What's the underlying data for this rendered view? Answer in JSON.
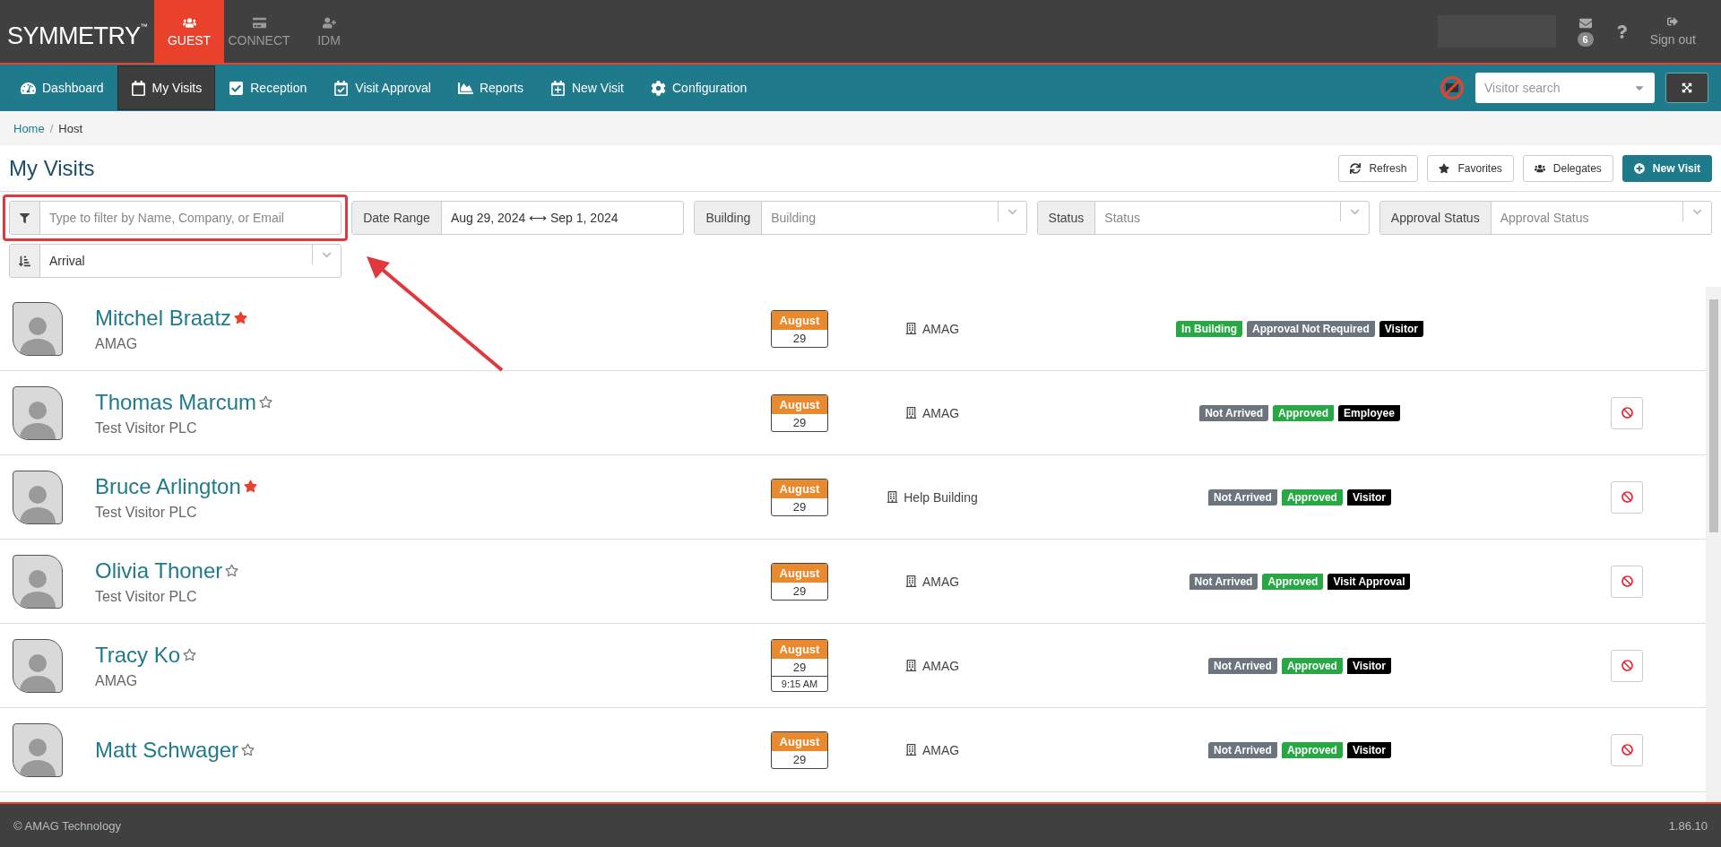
{
  "brand": {
    "name": "SYMMETRY",
    "mark": "™"
  },
  "products": [
    {
      "label": "GUEST",
      "selected": true
    },
    {
      "label": "CONNECT",
      "selected": false
    },
    {
      "label": "IDM",
      "selected": false
    }
  ],
  "user_menu": {
    "mail_count": "6",
    "sign_out": "Sign out"
  },
  "nav": [
    {
      "label": "Dashboard",
      "selected": false
    },
    {
      "label": "My Visits",
      "selected": true
    },
    {
      "label": "Reception",
      "selected": false
    },
    {
      "label": "Visit Approval",
      "selected": false
    },
    {
      "label": "Reports",
      "selected": false
    },
    {
      "label": "New Visit",
      "selected": false
    },
    {
      "label": "Configuration",
      "selected": false
    }
  ],
  "visitor_search": {
    "placeholder": "Visitor search"
  },
  "breadcrumb": {
    "items": [
      "Home",
      "Host"
    ],
    "separator": "/"
  },
  "page_title": "My Visits",
  "actions": [
    {
      "label": "Refresh",
      "primary": false
    },
    {
      "label": "Favorites",
      "primary": false
    },
    {
      "label": "Delegates",
      "primary": false
    },
    {
      "label": "New Visit",
      "primary": true
    }
  ],
  "filter": {
    "placeholder": "Type to filter by Name, Company, or Email"
  },
  "date_range": {
    "label": "Date Range",
    "start": "Aug 29, 2024",
    "separator": "⟷",
    "end": "Sep 1, 2024"
  },
  "selects": [
    {
      "label": "Building",
      "placeholder": "Building"
    },
    {
      "label": "Status",
      "placeholder": "Status"
    },
    {
      "label": "Approval Status",
      "placeholder": "Approval Status"
    }
  ],
  "sort": {
    "value": "Arrival"
  },
  "visits": [
    {
      "name": "Mitchel Braatz",
      "favorite": true,
      "company": "AMAG",
      "month": "August",
      "day": "29",
      "building": "AMAG",
      "cancelable": false,
      "badges": [
        {
          "text": "In Building",
          "color": "#28a745"
        },
        {
          "text": "Approval Not Required",
          "color": "#6c757d"
        },
        {
          "text": "Visitor",
          "color": "#000000"
        }
      ]
    },
    {
      "name": "Thomas Marcum",
      "favorite": false,
      "company": "Test Visitor PLC",
      "month": "August",
      "day": "29",
      "building": "AMAG",
      "cancelable": true,
      "badges": [
        {
          "text": "Not Arrived",
          "color": "#6c757d"
        },
        {
          "text": "Approved",
          "color": "#28a745"
        },
        {
          "text": "Employee",
          "color": "#000000"
        }
      ]
    },
    {
      "name": "Bruce Arlington",
      "favorite": true,
      "company": "Test Visitor PLC",
      "month": "August",
      "day": "29",
      "building": "Help Building",
      "cancelable": true,
      "badges": [
        {
          "text": "Not Arrived",
          "color": "#6c757d"
        },
        {
          "text": "Approved",
          "color": "#28a745"
        },
        {
          "text": "Visitor",
          "color": "#000000"
        }
      ]
    },
    {
      "name": "Olivia Thoner",
      "favorite": false,
      "company": "Test Visitor PLC",
      "month": "August",
      "day": "29",
      "building": "AMAG",
      "cancelable": true,
      "badges": [
        {
          "text": "Not Arrived",
          "color": "#6c757d"
        },
        {
          "text": "Approved",
          "color": "#28a745"
        },
        {
          "text": "Visit Approval",
          "color": "#000000"
        }
      ]
    },
    {
      "name": "Tracy Ko",
      "favorite": false,
      "company": "AMAG",
      "month": "August",
      "day": "29",
      "time": "9:15 AM",
      "building": "AMAG",
      "cancelable": true,
      "badges": [
        {
          "text": "Not Arrived",
          "color": "#6c757d"
        },
        {
          "text": "Approved",
          "color": "#28a745"
        },
        {
          "text": "Visitor",
          "color": "#000000"
        }
      ]
    },
    {
      "name": "Matt Schwager",
      "favorite": false,
      "month": "August",
      "day": "29",
      "building": "AMAG",
      "cancelable": true,
      "badges": [
        {
          "text": "Not Arrived",
          "color": "#6c757d"
        },
        {
          "text": "Approved",
          "color": "#28a745"
        },
        {
          "text": "Visitor",
          "color": "#000000"
        }
      ]
    }
  ],
  "footer": {
    "copyright": "© AMAG Technology",
    "version": "1.86.10"
  }
}
